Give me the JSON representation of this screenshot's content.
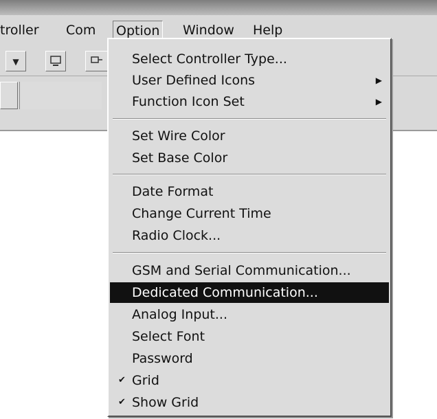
{
  "menubar": {
    "items": [
      {
        "label": "troller"
      },
      {
        "label": "Com"
      },
      {
        "label": "Option"
      },
      {
        "label": "Window"
      },
      {
        "label": "Help"
      }
    ]
  },
  "option_menu": {
    "items": [
      {
        "label": "Select Controller Type..."
      },
      {
        "label": "User Defined Icons",
        "submenu": true
      },
      {
        "label": "Function Icon Set",
        "submenu": true
      },
      {
        "label": "Set Wire Color"
      },
      {
        "label": "Set Base Color"
      },
      {
        "label": "Date Format"
      },
      {
        "label": "Change Current Time"
      },
      {
        "label": "Radio Clock..."
      },
      {
        "label": "GSM and Serial Communication..."
      },
      {
        "label": "Dedicated Communication...",
        "highlighted": true
      },
      {
        "label": "Analog Input..."
      },
      {
        "label": "Select Font"
      },
      {
        "label": "Password"
      },
      {
        "label": "Grid",
        "checked": true
      },
      {
        "label": "Show Grid",
        "checked": true
      }
    ]
  },
  "icons": {
    "check": "✔",
    "submenu_arrow": "▶",
    "dropdown_arrow": "▼"
  },
  "colors": {
    "menu_bg": "#dcdcdc",
    "highlight_bg": "#111111",
    "highlight_fg": "#ffffff"
  }
}
